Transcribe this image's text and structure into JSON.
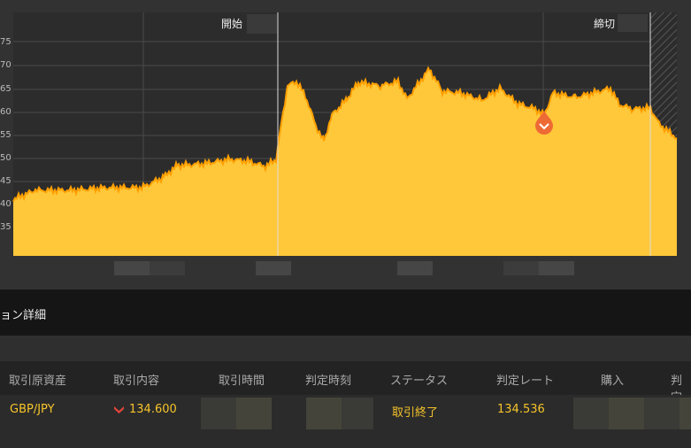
{
  "chart": {
    "start_label": "開始",
    "end_label": "締切",
    "y_ticks": [
      "75",
      "70",
      "65",
      "60",
      "55",
      "50",
      "45",
      "40",
      "35"
    ],
    "colors": {
      "fill": "#ffc83a",
      "line": "#ff9f00",
      "marker": "#ee6a35"
    }
  },
  "section": {
    "title": "ョン詳細"
  },
  "table": {
    "headers": [
      "取引原資産",
      "取引内容",
      "取引時間",
      "判定時刻",
      "ステータス",
      "判定レート",
      "購入",
      "判定"
    ],
    "row": {
      "asset": "GBP/JPY",
      "direction_icon": "down-arrow-icon",
      "rate": "134.600",
      "status": "取引終了",
      "judge_rate": "134.536"
    }
  }
}
